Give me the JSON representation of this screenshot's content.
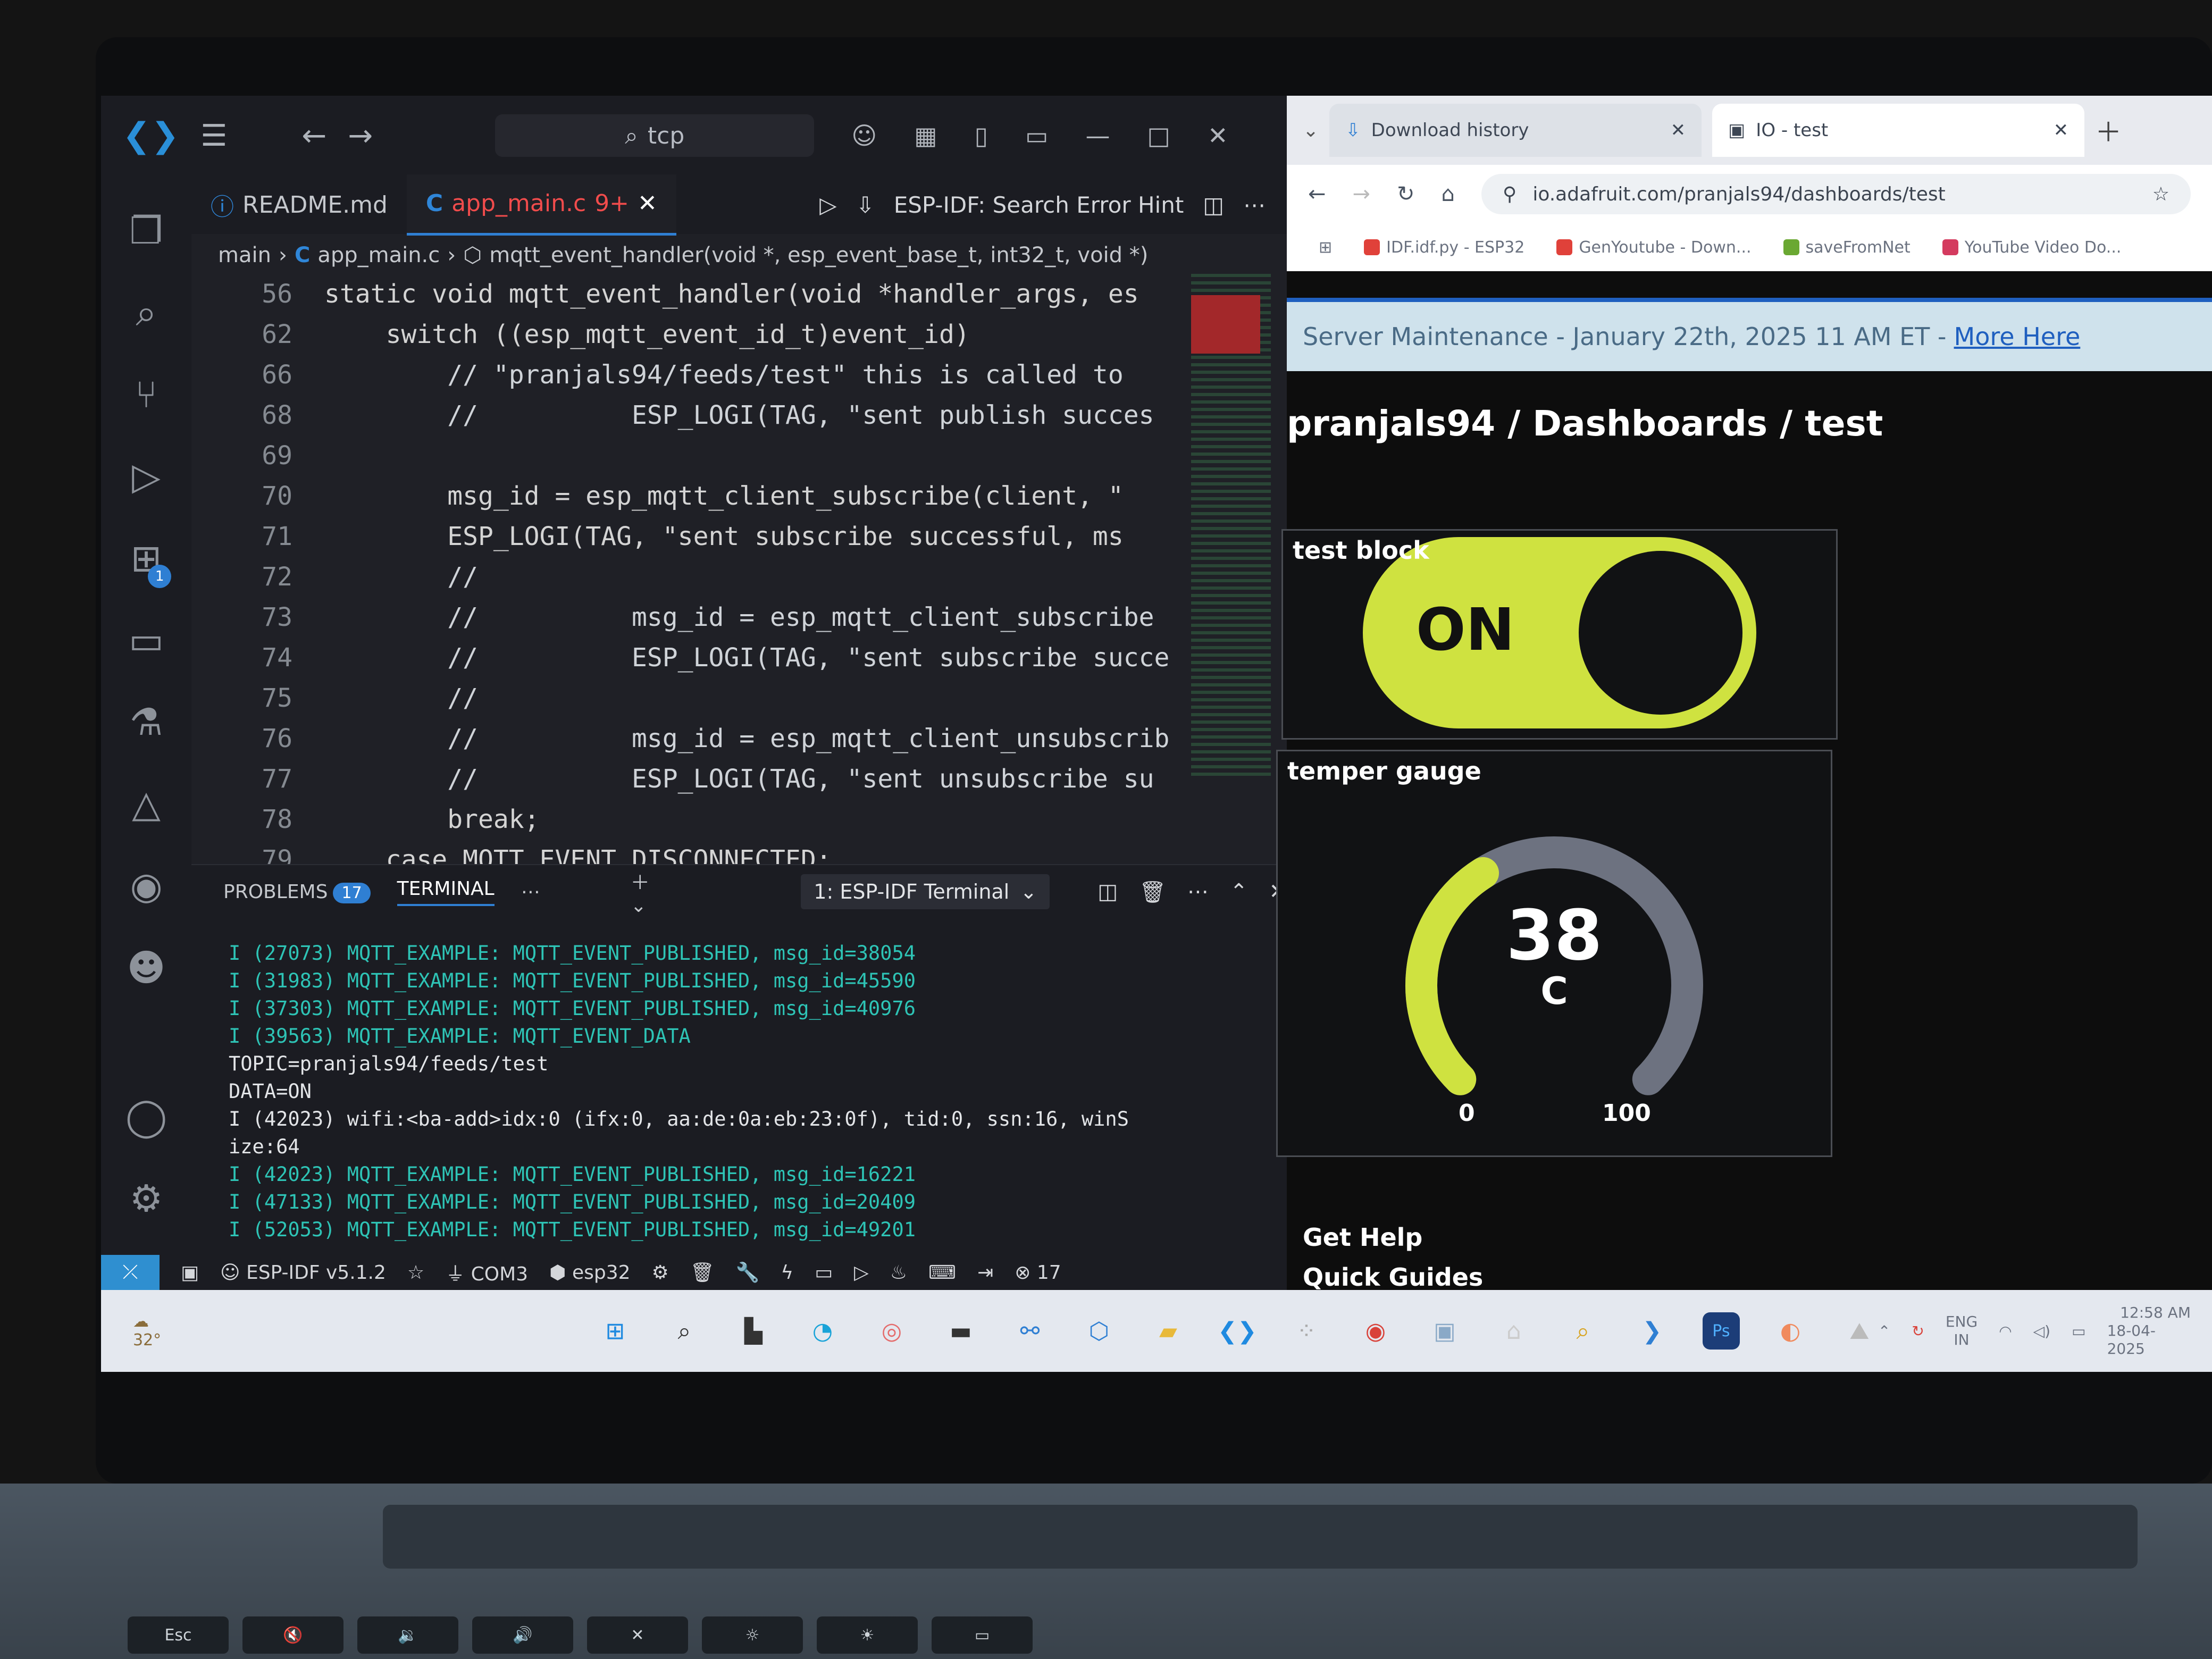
{
  "vscode": {
    "search": "tcp",
    "tabs": [
      {
        "label": "README.md",
        "mod": ""
      },
      {
        "label": "app_main.c",
        "mod": "9+"
      }
    ],
    "tab_tools": {
      "hint": "ESP-IDF: Search Error Hint"
    },
    "breadcrumb": {
      "folder": "main",
      "file": "app_main.c",
      "symbol": "mqtt_event_handler(void *, esp_event_base_t, int32_t, void *)"
    },
    "code": [
      {
        "n": "56",
        "t": "static void mqtt_event_handler(void *handler_args, es"
      },
      {
        "n": "62",
        "t": "    switch ((esp_mqtt_event_id_t)event_id)"
      },
      {
        "n": "66",
        "t": "        // \"pranjals94/feeds/test\" this is called to"
      },
      {
        "n": "68",
        "t": "        //          ESP_LOGI(TAG, \"sent publish succes"
      },
      {
        "n": "69",
        "t": ""
      },
      {
        "n": "70",
        "t": "        msg_id = esp_mqtt_client_subscribe(client, \""
      },
      {
        "n": "71",
        "t": "        ESP_LOGI(TAG, \"sent subscribe successful, ms"
      },
      {
        "n": "72",
        "t": "        //"
      },
      {
        "n": "73",
        "t": "        //          msg_id = esp_mqtt_client_subscribe"
      },
      {
        "n": "74",
        "t": "        //          ESP_LOGI(TAG, \"sent subscribe succe"
      },
      {
        "n": "75",
        "t": "        //"
      },
      {
        "n": "76",
        "t": "        //          msg_id = esp_mqtt_client_unsubscrib"
      },
      {
        "n": "77",
        "t": "        //          ESP_LOGI(TAG, \"sent unsubscribe su"
      },
      {
        "n": "78",
        "t": "        break;"
      },
      {
        "n": "79",
        "t": "    case MQTT_EVENT_DISCONNECTED:"
      }
    ],
    "panel": {
      "problems_label": "PROBLEMS",
      "problems_count": "17",
      "terminal_label": "TERMINAL",
      "terminal_select": "1: ESP-IDF Terminal"
    },
    "terminal_lines": [
      {
        "t": "I (27073) MQTT_EXAMPLE: MQTT_EVENT_PUBLISHED, msg_id=38054",
        "c": "cy"
      },
      {
        "t": "I (31983) MQTT_EXAMPLE: MQTT_EVENT_PUBLISHED, msg_id=45590",
        "c": "cy"
      },
      {
        "t": "I (37303) MQTT_EXAMPLE: MQTT_EVENT_PUBLISHED, msg_id=40976",
        "c": "cy"
      },
      {
        "t": "I (39563) MQTT_EXAMPLE: MQTT_EVENT_DATA",
        "c": "cy"
      },
      {
        "t": "TOPIC=pranjals94/feeds/test",
        "c": "wh"
      },
      {
        "t": "DATA=ON",
        "c": "wh"
      },
      {
        "t": "I (42023) wifi:<ba-add>idx:0 (ifx:0, aa:de:0a:eb:23:0f), tid:0, ssn:16, winS",
        "c": "wh"
      },
      {
        "t": "ize:64",
        "c": "wh"
      },
      {
        "t": "I (42023) MQTT_EXAMPLE: MQTT_EVENT_PUBLISHED, msg_id=16221",
        "c": "cy"
      },
      {
        "t": "I (47133) MQTT_EXAMPLE: MQTT_EVENT_PUBLISHED, msg_id=20409",
        "c": "cy"
      },
      {
        "t": "I (52053) MQTT_EXAMPLE: MQTT_EVENT_PUBLISHED, msg_id=49201",
        "c": "cy"
      }
    ],
    "status": {
      "idf": "ESP-IDF v5.1.2",
      "port": "COM3",
      "target": "esp32",
      "errors": "17"
    }
  },
  "browser": {
    "tabs": [
      {
        "label": "Download history"
      },
      {
        "label": "IO - test"
      }
    ],
    "url": "io.adafruit.com/pranjals94/dashboards/test",
    "bookmarks": [
      {
        "label": "IDF.idf.py - ESP32",
        "color": "#e0413a"
      },
      {
        "label": "GenYoutube - Down...",
        "color": "#e0413a"
      },
      {
        "label": "saveFromNet",
        "color": "#6aa832"
      },
      {
        "label": "YouTube Video Do...",
        "color": "#d43b5f"
      }
    ],
    "banner": {
      "text": "Server Maintenance - January 22th, 2025 11 AM ET -",
      "link": "More Here"
    },
    "dashboard_title": "pranjals94 / Dashboards / test",
    "toggle_block": {
      "title": "test block",
      "state": "ON",
      "accent": "#cfe240"
    },
    "gauge_block": {
      "title": "temper gauge",
      "value": "38",
      "unit": "C",
      "min": "0",
      "max": "100",
      "fraction": 0.38
    },
    "footer": {
      "help": "Get Help",
      "guides": "Quick Guides"
    }
  },
  "taskbar": {
    "lang": "ENG",
    "region": "IN",
    "time": "12:58 AM",
    "date": "18-04-2025",
    "weather": "32°"
  },
  "keyboard": {
    "esc": "Esc"
  }
}
